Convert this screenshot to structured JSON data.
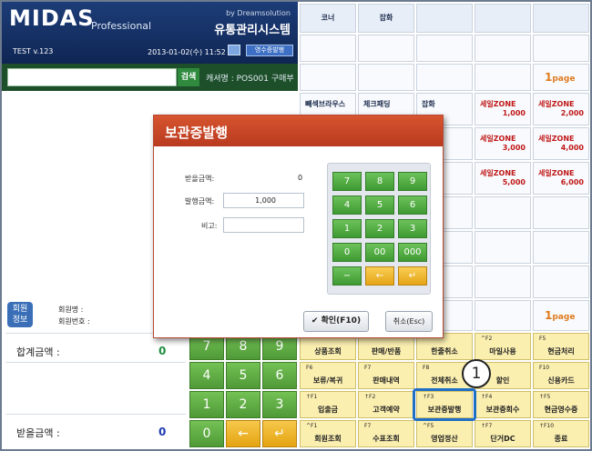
{
  "header": {
    "logo": "MIDAS",
    "logo_sub": "Professional",
    "vendor": "by Dreamsolution",
    "system": "유통관리시스템",
    "version": "TEST v.123",
    "datetime": "2013-01-02(수) 11:52",
    "receipt_btn": "영수증발행"
  },
  "search": {
    "button": "검색",
    "cashier": "캐셔명 : POS001 구매부"
  },
  "member": {
    "badge": "회원\n정보",
    "name_label": "회원명 :",
    "no_label": "회원번호 :"
  },
  "totals": {
    "total_label": "합계금액 :",
    "total_value": "0",
    "received_label": "받을금액 :",
    "received_value": "0"
  },
  "categories": [
    "코너",
    "잡화"
  ],
  "products": [
    {
      "name": "빼섹브라우스",
      "price": ""
    },
    {
      "name": "체크패딩",
      "price": ""
    },
    {
      "name": "잡화",
      "price": ""
    },
    {
      "name": "세일ZONE",
      "price": "1,000"
    },
    {
      "name": "세일ZONE",
      "price": "2,000"
    },
    {
      "name": "세일ZONE",
      "price": "3,000"
    },
    {
      "name": "세일ZONE",
      "price": "4,000"
    },
    {
      "name": "세일ZONE",
      "price": "5,000"
    },
    {
      "name": "세일ZONE",
      "price": "6,000"
    }
  ],
  "page": {
    "num": "1",
    "label": "page"
  },
  "keypad": [
    "7",
    "8",
    "9",
    "4",
    "5",
    "6",
    "1",
    "2",
    "3",
    "0",
    "←",
    "↵"
  ],
  "functions": [
    {
      "key": "",
      "label": "상품조회"
    },
    {
      "key": "",
      "label": "판매/반품"
    },
    {
      "key": "",
      "label": "한줄취소"
    },
    {
      "key": "^F2",
      "label": "마일사용"
    },
    {
      "key": "F5",
      "label": "현금처리"
    },
    {
      "key": "F6",
      "label": "보류/복귀"
    },
    {
      "key": "F7",
      "label": "판매내역"
    },
    {
      "key": "F8",
      "label": "전체취소"
    },
    {
      "key": "",
      "label": "할인"
    },
    {
      "key": "F10",
      "label": "신용카드"
    },
    {
      "key": "↑F1",
      "label": "입출금"
    },
    {
      "key": "↑F2",
      "label": "고객예약"
    },
    {
      "key": "↑F3",
      "label": "보관증발행"
    },
    {
      "key": "↑F4",
      "label": "보관증회수"
    },
    {
      "key": "↑F5",
      "label": "현금영수증"
    },
    {
      "key": "^F1",
      "label": "회원조회"
    },
    {
      "key": "F7",
      "label": "수표조회"
    },
    {
      "key": "^F5",
      "label": "영업정산"
    },
    {
      "key": "↑F7",
      "label": "단거DC"
    },
    {
      "key": "↑F10",
      "label": "종료"
    }
  ],
  "modal": {
    "title": "보관증발행",
    "recv_label": "받을금액:",
    "recv_value": "0",
    "issue_label": "발행금액:",
    "issue_value": "1,000",
    "note_label": "비고:",
    "keys": [
      "7",
      "8",
      "9",
      "4",
      "5",
      "6",
      "1",
      "2",
      "3",
      "0",
      "00",
      "000",
      "−",
      "←",
      "↵"
    ],
    "ok": "✔ 확인(F10)",
    "cancel": "취소(Esc)"
  },
  "callout": "1"
}
